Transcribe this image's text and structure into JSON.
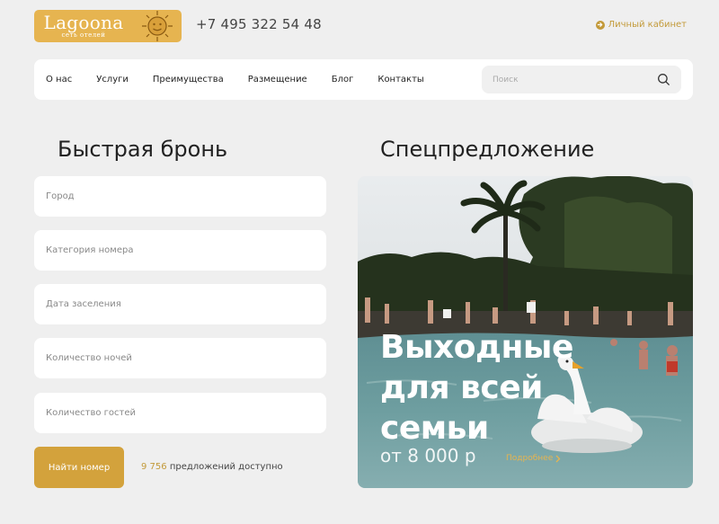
{
  "brand": {
    "name": "Lagoona",
    "subtitle": "сеть отелей",
    "color": "#e6b450"
  },
  "header": {
    "phone": "+7 495 322 54 48",
    "account_label": "Личный кабинет"
  },
  "nav": {
    "items": [
      "О нас",
      "Услуги",
      "Преимущества",
      "Размещение",
      "Блог",
      "Контакты"
    ],
    "search_placeholder": "Поиск"
  },
  "booking": {
    "title": "Быстрая бронь",
    "fields": [
      {
        "placeholder": "Город"
      },
      {
        "placeholder": "Категория номера"
      },
      {
        "placeholder": "Дата заселения"
      },
      {
        "placeholder": "Количество ночей"
      },
      {
        "placeholder": "Количество гостей"
      }
    ],
    "submit_label": "Найти номер",
    "offers_count": "9 756",
    "offers_text": "предложений доступно"
  },
  "special": {
    "title": "Спецпредложение",
    "promo_lines": [
      "Выходные",
      "для всей",
      "семьи"
    ],
    "price": "от 8 000 р",
    "more_label": "Подробнее"
  },
  "colors": {
    "accent": "#d3a23c",
    "background": "#efefef"
  }
}
